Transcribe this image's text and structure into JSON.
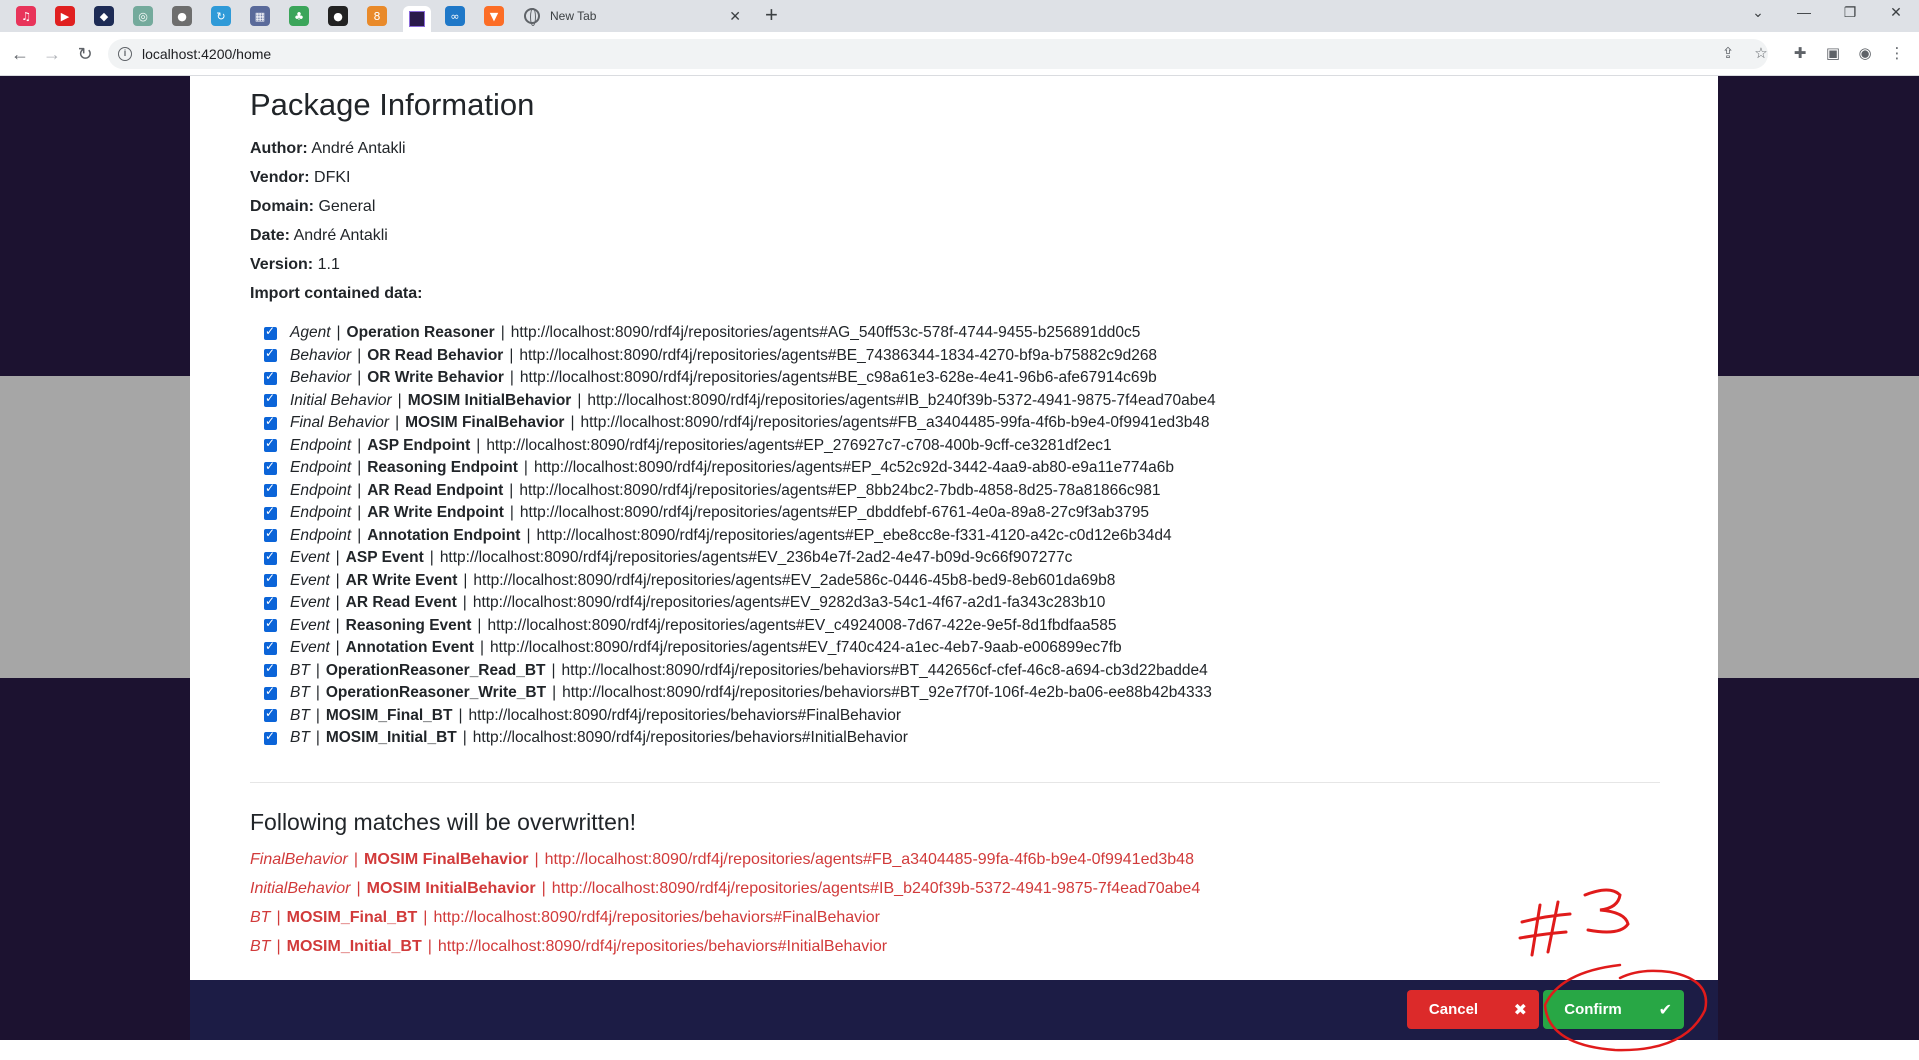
{
  "browser": {
    "tab_icons": [
      "music-app-icon",
      "youtube-icon",
      "codepen-icon",
      "chatgpt-icon",
      "ring-icon",
      "refresh-app-icon",
      "dfki-icon",
      "leaf-icon",
      "github-icon",
      "tor-icon",
      "rider-icon",
      "nextcloud-icon",
      "gitlab-icon"
    ],
    "new_tab_label": "New Tab",
    "url": "localhost:4200/home"
  },
  "package": {
    "title": "Package Information",
    "fields": [
      {
        "label": "Author:",
        "value": "André Antakli"
      },
      {
        "label": "Vendor:",
        "value": "DFKI"
      },
      {
        "label": "Domain:",
        "value": "General"
      },
      {
        "label": "Date:",
        "value": "André Antakli"
      },
      {
        "label": "Version:",
        "value": "1.1"
      }
    ],
    "import_label": "Import contained data:",
    "items": [
      {
        "type": "Agent",
        "name": "Operation Reasoner",
        "uri": "http://localhost:8090/rdf4j/repositories/agents#AG_540ff53c-578f-4744-9455-b256891dd0c5",
        "checked": true
      },
      {
        "type": "Behavior",
        "name": "OR Read Behavior",
        "uri": "http://localhost:8090/rdf4j/repositories/agents#BE_74386344-1834-4270-bf9a-b75882c9d268",
        "checked": true
      },
      {
        "type": "Behavior",
        "name": "OR Write Behavior",
        "uri": "http://localhost:8090/rdf4j/repositories/agents#BE_c98a61e3-628e-4e41-96b6-afe67914c69b",
        "checked": true
      },
      {
        "type": "Initial Behavior",
        "name": "MOSIM InitialBehavior",
        "uri": "http://localhost:8090/rdf4j/repositories/agents#IB_b240f39b-5372-4941-9875-7f4ead70abe4",
        "checked": true
      },
      {
        "type": "Final Behavior",
        "name": "MOSIM FinalBehavior",
        "uri": "http://localhost:8090/rdf4j/repositories/agents#FB_a3404485-99fa-4f6b-b9e4-0f9941ed3b48",
        "checked": true
      },
      {
        "type": "Endpoint",
        "name": "ASP Endpoint",
        "uri": "http://localhost:8090/rdf4j/repositories/agents#EP_276927c7-c708-400b-9cff-ce3281df2ec1",
        "checked": true
      },
      {
        "type": "Endpoint",
        "name": "Reasoning Endpoint",
        "uri": "http://localhost:8090/rdf4j/repositories/agents#EP_4c52c92d-3442-4aa9-ab80-e9a11e774a6b",
        "checked": true
      },
      {
        "type": "Endpoint",
        "name": "AR Read Endpoint",
        "uri": "http://localhost:8090/rdf4j/repositories/agents#EP_8bb24bc2-7bdb-4858-8d25-78a81866c981",
        "checked": true
      },
      {
        "type": "Endpoint",
        "name": "AR Write Endpoint",
        "uri": "http://localhost:8090/rdf4j/repositories/agents#EP_dbddfebf-6761-4e0a-89a8-27c9f3ab3795",
        "checked": true
      },
      {
        "type": "Endpoint",
        "name": "Annotation Endpoint",
        "uri": "http://localhost:8090/rdf4j/repositories/agents#EP_ebe8cc8e-f331-4120-a42c-c0d12e6b34d4",
        "checked": true
      },
      {
        "type": "Event",
        "name": "ASP Event",
        "uri": "http://localhost:8090/rdf4j/repositories/agents#EV_236b4e7f-2ad2-4e47-b09d-9c66f907277c",
        "checked": true
      },
      {
        "type": "Event",
        "name": "AR Write Event",
        "uri": "http://localhost:8090/rdf4j/repositories/agents#EV_2ade586c-0446-45b8-bed9-8eb601da69b8",
        "checked": true
      },
      {
        "type": "Event",
        "name": "AR Read Event",
        "uri": "http://localhost:8090/rdf4j/repositories/agents#EV_9282d3a3-54c1-4f67-a2d1-fa343c283b10",
        "checked": true
      },
      {
        "type": "Event",
        "name": "Reasoning Event",
        "uri": "http://localhost:8090/rdf4j/repositories/agents#EV_c4924008-7d67-422e-9e5f-8d1fbdfaa585",
        "checked": true
      },
      {
        "type": "Event",
        "name": "Annotation Event",
        "uri": "http://localhost:8090/rdf4j/repositories/agents#EV_f740c424-a1ec-4eb7-9aab-e006899ec7fb",
        "checked": true
      },
      {
        "type": "BT",
        "name": "OperationReasoner_Read_BT",
        "uri": "http://localhost:8090/rdf4j/repositories/behaviors#BT_442656cf-cfef-46c8-a694-cb3d22badde4",
        "checked": true
      },
      {
        "type": "BT",
        "name": "OperationReasoner_Write_BT",
        "uri": "http://localhost:8090/rdf4j/repositories/behaviors#BT_92e7f70f-106f-4e2b-ba06-ee88b42b4333",
        "checked": true
      },
      {
        "type": "BT",
        "name": "MOSIM_Final_BT",
        "uri": "http://localhost:8090/rdf4j/repositories/behaviors#FinalBehavior",
        "checked": true
      },
      {
        "type": "BT",
        "name": "MOSIM_Initial_BT",
        "uri": "http://localhost:8090/rdf4j/repositories/behaviors#InitialBehavior",
        "checked": true
      }
    ]
  },
  "overwrite": {
    "title": "Following matches will be overwritten!",
    "items": [
      {
        "type": "FinalBehavior",
        "name": "MOSIM FinalBehavior",
        "uri": "http://localhost:8090/rdf4j/repositories/agents#FB_a3404485-99fa-4f6b-b9e4-0f9941ed3b48"
      },
      {
        "type": "InitialBehavior",
        "name": "MOSIM InitialBehavior",
        "uri": "http://localhost:8090/rdf4j/repositories/agents#IB_b240f39b-5372-4941-9875-7f4ead70abe4"
      },
      {
        "type": "BT",
        "name": "MOSIM_Final_BT",
        "uri": "http://localhost:8090/rdf4j/repositories/behaviors#FinalBehavior"
      },
      {
        "type": "BT",
        "name": "MOSIM_Initial_BT",
        "uri": "http://localhost:8090/rdf4j/repositories/behaviors#InitialBehavior"
      }
    ]
  },
  "footer": {
    "cancel_label": "Cancel",
    "confirm_label": "Confirm"
  },
  "annotation": {
    "text": "#3"
  },
  "colors": {
    "overwrite_red": "#d13a3a",
    "cancel_red": "#dc2a2a",
    "confirm_green": "#28a745",
    "checkbox_blue": "#0b64d8",
    "footer_navy": "#1c1c45"
  }
}
